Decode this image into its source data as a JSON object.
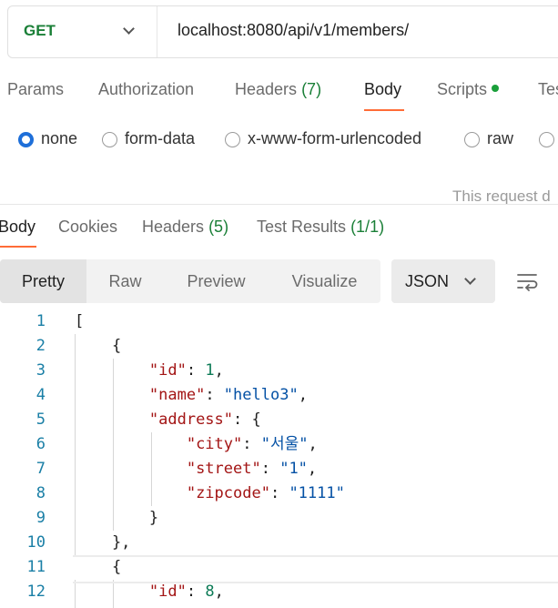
{
  "request": {
    "method": "GET",
    "url": "localhost:8080/api/v1/members/"
  },
  "request_tabs": [
    {
      "label": "Params"
    },
    {
      "label": "Authorization"
    },
    {
      "label": "Headers",
      "count": "(7)"
    },
    {
      "label": "Body",
      "active": true
    },
    {
      "label": "Scripts"
    },
    {
      "label": "Tes"
    }
  ],
  "body_types": [
    {
      "label": "none",
      "selected": true
    },
    {
      "label": "form-data"
    },
    {
      "label": "x-www-form-urlencoded"
    },
    {
      "label": "raw"
    }
  ],
  "body_info_text": "This request d",
  "response_tabs": [
    {
      "label": "Body",
      "active": true
    },
    {
      "label": "Cookies"
    },
    {
      "label": "Headers",
      "count": "(5)"
    },
    {
      "label": "Test Results",
      "count": "(1/1)"
    }
  ],
  "view_modes": [
    "Pretty",
    "Raw",
    "Preview",
    "Visualize"
  ],
  "format": "JSON",
  "code_lines": [
    {
      "n": "1"
    },
    {
      "n": "2"
    },
    {
      "n": "3"
    },
    {
      "n": "4"
    },
    {
      "n": "5"
    },
    {
      "n": "6"
    },
    {
      "n": "7"
    },
    {
      "n": "8"
    },
    {
      "n": "9"
    },
    {
      "n": "10"
    },
    {
      "n": "11"
    },
    {
      "n": "12"
    }
  ],
  "json_values": {
    "k_id": "\"id\"",
    "k_name": "\"name\"",
    "k_address": "\"address\"",
    "k_city": "\"city\"",
    "k_street": "\"street\"",
    "k_zipcode": "\"zipcode\"",
    "id_1": "1",
    "name_1": "\"hello3\"",
    "city_1": "\"서울\"",
    "street_1": "\"1\"",
    "zipcode_1": "\"1111\"",
    "id_2": "8"
  },
  "colors": {
    "accent": "#ff6c37",
    "method_green": "#1a7f37",
    "radio_selected": "#1e6fd9",
    "json_key": "#a31515",
    "json_string": "#0451a5",
    "json_number": "#0b7a55"
  }
}
